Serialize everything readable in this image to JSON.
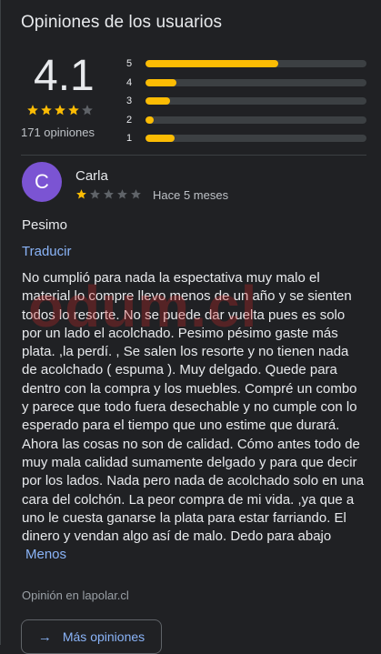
{
  "section": {
    "title": "Opiniones de los usuarios"
  },
  "summary": {
    "score": "4.1",
    "stars_filled": 4,
    "stars_total": 5,
    "count_label": "171 opiniones",
    "distribution": [
      {
        "label": "5",
        "fraction": 0.6
      },
      {
        "label": "4",
        "fraction": 0.14
      },
      {
        "label": "3",
        "fraction": 0.11
      },
      {
        "label": "2",
        "fraction": 0.035
      },
      {
        "label": "1",
        "fraction": 0.13
      }
    ]
  },
  "review": {
    "avatar_letter": "C",
    "author": "Carla",
    "stars_filled": 1,
    "stars_total": 5,
    "time": "Hace 5 meses",
    "title": "Pesimo",
    "translate_label": "Traducir",
    "body": "No cumplió para nada la espectativa muy malo el material lo compre llevo menos de un año y se sienten todos lo resorte. No se puede dar vuelta pues es solo por un lado el acolchado. Pesimo pésimo gaste más plata. ,la perdí. , Se salen los resorte y no tienen nada de acolchado ( espuma ). Muy delgado. Quede para dentro con la compra y los muebles. Compré un combo y parece que todo fuera desechable y no cumple con lo esperado para el tiempo que uno estime que durará. Ahora las cosas no son de calidad. Cómo antes todo de muy mala calidad sumamente delgado y para que decir por los lados. Nada pero nada de acolchado solo en una cara del colchón. La peor compra de mi vida. ,ya que a uno le cuesta ganarse la plata para estar farriando. El dinero y vendan algo así de malo. Dedo para abajo",
    "less_label": "Menos",
    "source": "Opinión en lapolar.cl"
  },
  "watermark": {
    "text": "odum.cl"
  },
  "more_button": {
    "label": "Más opiniones",
    "icon": "arrow-right-icon"
  },
  "colors": {
    "background": "#202124",
    "star_filled": "#fbbc04",
    "star_empty": "#5f6368",
    "link": "#8ab4f8",
    "avatar": "#7b54d3"
  }
}
